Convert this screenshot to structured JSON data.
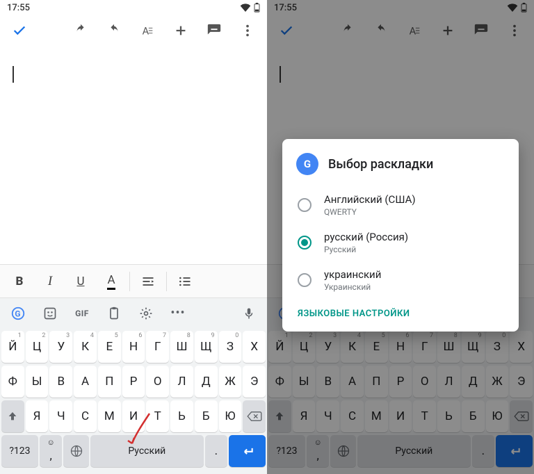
{
  "status": {
    "time": "17:55"
  },
  "format": {
    "bold": "B",
    "italic": "I",
    "underline": "U",
    "color": "A"
  },
  "suggestion": {
    "gif": "GIF",
    "more": "•••"
  },
  "keyboard": {
    "row1": [
      "Й",
      "Ц",
      "У",
      "К",
      "Е",
      "Н",
      "Г",
      "Ш",
      "Щ",
      "З",
      "Х"
    ],
    "row1sup": [
      "1",
      "2",
      "3",
      "4",
      "5",
      "6",
      "7",
      "8",
      "9",
      "0",
      ""
    ],
    "row2": [
      "Ф",
      "Ы",
      "В",
      "А",
      "П",
      "Р",
      "О",
      "Л",
      "Д",
      "Ж",
      "Э"
    ],
    "row3": [
      "Я",
      "Ч",
      "С",
      "М",
      "И",
      "Т",
      "Ь",
      "Б",
      "Ю"
    ],
    "num": "?123",
    "space": "Русский",
    "period": "."
  },
  "dialog": {
    "title": "Выбор раскладки",
    "opt1": {
      "label": "Английский (США)",
      "sub": "QWERTY"
    },
    "opt2": {
      "label": "русский (Россия)",
      "sub": "Русский"
    },
    "opt3": {
      "label": "украинский",
      "sub": "Украинский"
    },
    "link": "ЯЗЫКОВЫЕ НАСТРОЙКИ"
  }
}
